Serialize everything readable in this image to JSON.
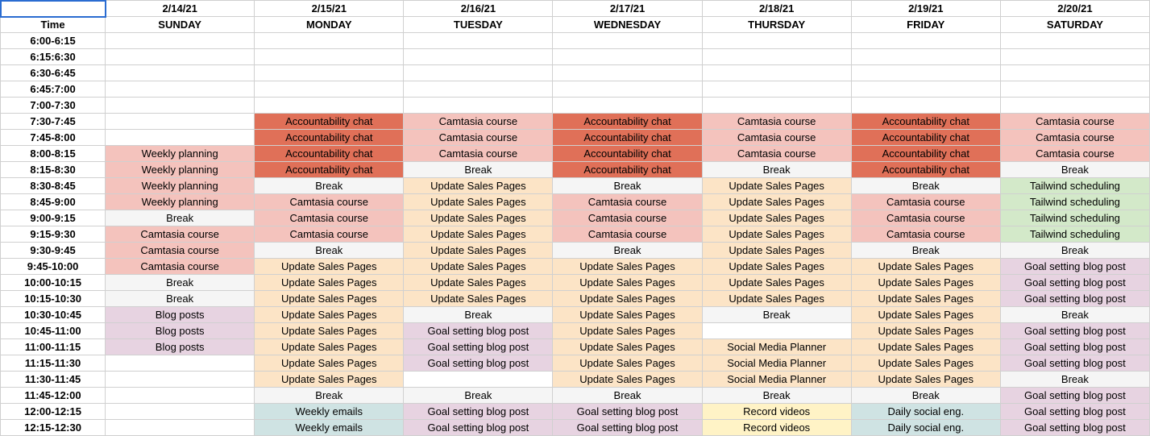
{
  "header": {
    "time_label": "Time",
    "dates": [
      "2/14/21",
      "2/15/21",
      "2/16/21",
      "2/17/21",
      "2/18/21",
      "2/19/21",
      "2/20/21"
    ],
    "days": [
      "SUNDAY",
      "MONDAY",
      "TUESDAY",
      "WEDNESDAY",
      "THURSDAY",
      "FRIDAY",
      "SATURDAY"
    ]
  },
  "palette": {
    "Accountability chat": "c-red",
    "Camtasia course": "c-pink",
    "Weekly planning": "c-pink",
    "Break": "c-grey",
    "Update Sales Pages": "c-peach",
    "Tailwind scheduling": "c-green",
    "Blog posts": "c-mauve",
    "Goal setting blog post": "c-mauve",
    "Social Media Planner": "c-peach",
    "Weekly emails": "c-teal",
    "Daily social eng.": "c-teal",
    "Record videos": "c-yellow"
  },
  "rows": [
    {
      "time": "6:00-6:15",
      "cells": [
        "",
        "",
        "",
        "",
        "",
        "",
        ""
      ]
    },
    {
      "time": "6:15:6:30",
      "cells": [
        "",
        "",
        "",
        "",
        "",
        "",
        ""
      ]
    },
    {
      "time": "6:30-6:45",
      "cells": [
        "",
        "",
        "",
        "",
        "",
        "",
        ""
      ]
    },
    {
      "time": "6:45:7:00",
      "cells": [
        "",
        "",
        "",
        "",
        "",
        "",
        ""
      ]
    },
    {
      "time": "7:00-7:30",
      "cells": [
        "",
        "",
        "",
        "",
        "",
        "",
        ""
      ]
    },
    {
      "time": "7:30-7:45",
      "cells": [
        "",
        "Accountability chat",
        "Camtasia course",
        "Accountability chat",
        "Camtasia course",
        "Accountability chat",
        "Camtasia course"
      ]
    },
    {
      "time": "7:45-8:00",
      "cells": [
        "",
        "Accountability chat",
        "Camtasia course",
        "Accountability chat",
        "Camtasia course",
        "Accountability chat",
        "Camtasia course"
      ]
    },
    {
      "time": "8:00-8:15",
      "cells": [
        "Weekly planning",
        "Accountability chat",
        "Camtasia course",
        "Accountability chat",
        "Camtasia course",
        "Accountability chat",
        "Camtasia course"
      ]
    },
    {
      "time": "8:15-8:30",
      "cells": [
        "Weekly planning",
        "Accountability chat",
        "Break",
        "Accountability chat",
        "Break",
        "Accountability chat",
        "Break"
      ]
    },
    {
      "time": "8:30-8:45",
      "cells": [
        "Weekly planning",
        "Break",
        "Update Sales Pages",
        "Break",
        "Update Sales Pages",
        "Break",
        "Tailwind scheduling"
      ]
    },
    {
      "time": "8:45-9:00",
      "cells": [
        "Weekly planning",
        "Camtasia course",
        "Update Sales Pages",
        "Camtasia course",
        "Update Sales Pages",
        "Camtasia course",
        "Tailwind scheduling"
      ]
    },
    {
      "time": "9:00-9:15",
      "cells": [
        "Break",
        "Camtasia course",
        "Update Sales Pages",
        "Camtasia course",
        "Update Sales Pages",
        "Camtasia course",
        "Tailwind scheduling"
      ]
    },
    {
      "time": "9:15-9:30",
      "cells": [
        "Camtasia course",
        "Camtasia course",
        "Update Sales Pages",
        "Camtasia course",
        "Update Sales Pages",
        "Camtasia course",
        "Tailwind scheduling"
      ]
    },
    {
      "time": "9:30-9:45",
      "cells": [
        "Camtasia course",
        "Break",
        "Update Sales Pages",
        "Break",
        "Update Sales Pages",
        "Break",
        "Break"
      ]
    },
    {
      "time": "9:45-10:00",
      "cells": [
        "Camtasia course",
        "Update Sales Pages",
        "Update Sales Pages",
        "Update Sales Pages",
        "Update Sales Pages",
        "Update Sales Pages",
        "Goal setting blog post"
      ]
    },
    {
      "time": "10:00-10:15",
      "cells": [
        "Break",
        "Update Sales Pages",
        "Update Sales Pages",
        "Update Sales Pages",
        "Update Sales Pages",
        "Update Sales Pages",
        "Goal setting blog post"
      ]
    },
    {
      "time": "10:15-10:30",
      "cells": [
        "Break",
        "Update Sales Pages",
        "Update Sales Pages",
        "Update Sales Pages",
        "Update Sales Pages",
        "Update Sales Pages",
        "Goal setting blog post"
      ]
    },
    {
      "time": "10:30-10:45",
      "cells": [
        "Blog posts",
        "Update Sales Pages",
        "Break",
        "Update Sales Pages",
        "Break",
        "Update Sales Pages",
        "Break"
      ]
    },
    {
      "time": "10:45-11:00",
      "cells": [
        "Blog posts",
        "Update Sales Pages",
        "Goal setting blog post",
        "Update Sales Pages",
        "",
        "Update Sales Pages",
        "Goal setting blog post"
      ]
    },
    {
      "time": "11:00-11:15",
      "cells": [
        "Blog posts",
        "Update Sales Pages",
        "Goal setting blog post",
        "Update Sales Pages",
        "Social Media Planner",
        "Update Sales Pages",
        "Goal setting blog post"
      ]
    },
    {
      "time": "11:15-11:30",
      "cells": [
        "",
        "Update Sales Pages",
        "Goal setting blog post",
        "Update Sales Pages",
        "Social Media Planner",
        "Update Sales Pages",
        "Goal setting blog post"
      ]
    },
    {
      "time": "11:30-11:45",
      "cells": [
        "",
        "Update Sales Pages",
        "",
        "Update Sales Pages",
        "Social Media Planner",
        "Update Sales Pages",
        "Break"
      ]
    },
    {
      "time": "11:45-12:00",
      "cells": [
        "",
        "Break",
        "Break",
        "Break",
        "Break",
        "Break",
        "Goal setting blog post"
      ]
    },
    {
      "time": "12:00-12:15",
      "cells": [
        "",
        "Weekly emails",
        "Goal setting blog post",
        "Goal setting blog post",
        "Record videos",
        "Daily social eng.",
        "Goal setting blog post"
      ]
    },
    {
      "time": "12:15-12:30",
      "cells": [
        "",
        "Weekly emails",
        "Goal setting blog post",
        "Goal setting blog post",
        "Record videos",
        "Daily social eng.",
        "Goal setting blog post"
      ]
    }
  ]
}
